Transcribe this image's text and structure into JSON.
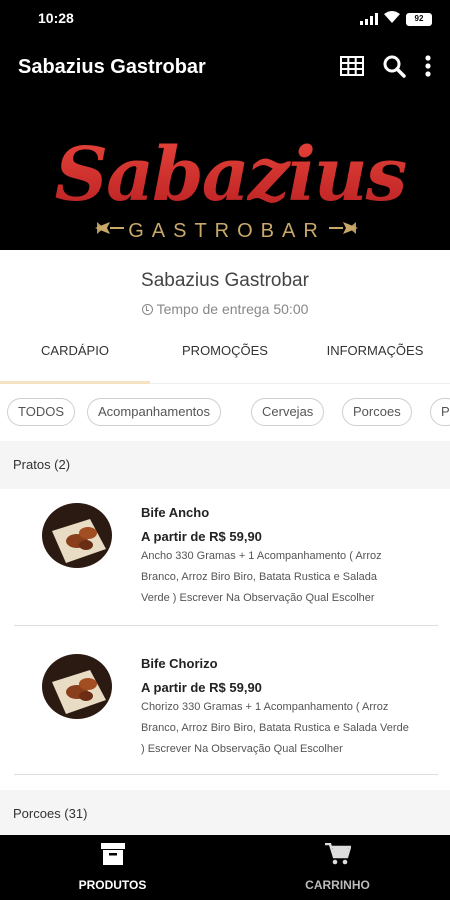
{
  "status_bar": {
    "time": "10:28",
    "battery": "92"
  },
  "app_bar": {
    "title": "Sabazius Gastrobar",
    "icons": [
      "grid-view-icon",
      "search-icon",
      "more-vert-icon"
    ]
  },
  "banner": {
    "logo_script": "Sabazius",
    "logo_sub": "GASTROBAR"
  },
  "store": {
    "name": "Sabazius Gastrobar",
    "delivery": "Tempo de entrega 50:00"
  },
  "tabs": [
    {
      "label": "CARDÁPIO",
      "active": true
    },
    {
      "label": "PROMOÇÕES",
      "active": false
    },
    {
      "label": "INFORMAÇÕES",
      "active": false
    }
  ],
  "chips": [
    "TODOS",
    "Acompanhamentos",
    "Cervejas",
    "Porcoes",
    "P"
  ],
  "sections": [
    {
      "title": "Pratos (2)",
      "products": [
        {
          "name": "Bife Ancho",
          "price": "A partir de R$ 59,90",
          "desc_lines": [
            "Ancho 330 Gramas + 1 Acompanhamento ( Arroz",
            "Branco, Arroz Biro Biro, Batata Rustica e Salada",
            "Verde ) Escrever Na Observação Qual Escolher"
          ]
        },
        {
          "name": "Bife Chorizo",
          "price": "A partir de R$ 59,90",
          "desc_lines": [
            "Chorizo 330 Gramas + 1 Acompanhamento ( Arroz",
            "Branco, Arroz Biro Biro, Batata Rustica e Salada Verde",
            ") Escrever Na Observação Qual Escolher"
          ]
        }
      ]
    },
    {
      "title": "Porcoes (31)",
      "products": []
    }
  ],
  "bottom_nav": [
    {
      "label": "PRODUTOS",
      "icon": "archive-box-icon",
      "active": true
    },
    {
      "label": "CARRINHO",
      "icon": "cart-icon",
      "active": false
    }
  ],
  "colors": {
    "brand_red": "#d42b2b",
    "brand_gold": "#c9a96a",
    "tab_indicator": "#f3e3c2",
    "nav_active": "#ffffff",
    "nav_inactive": "#bbbbbb"
  }
}
